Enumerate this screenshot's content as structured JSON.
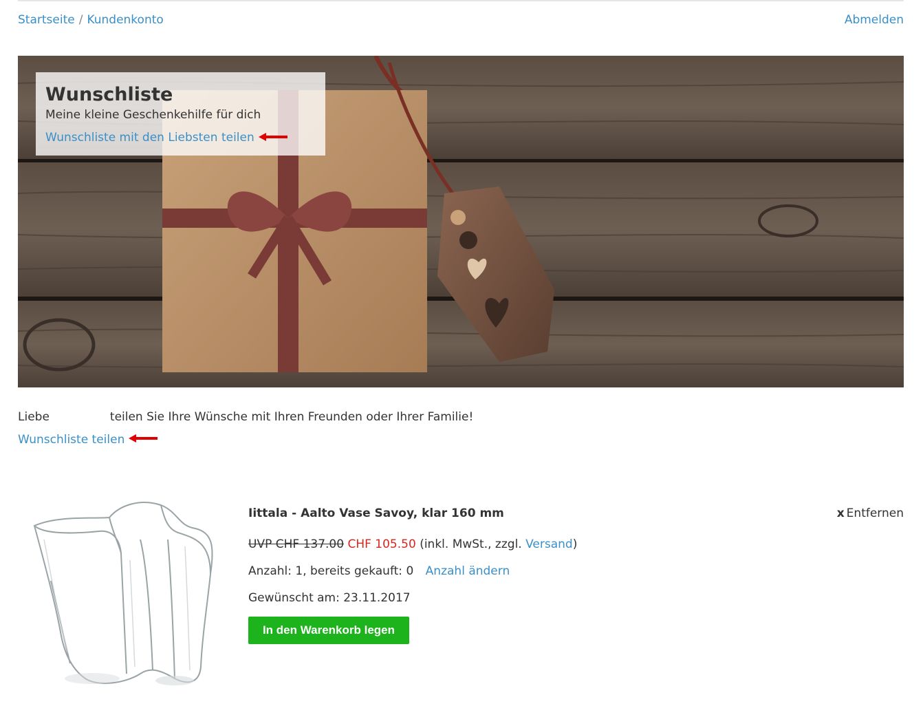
{
  "breadcrumb": {
    "home": "Startseite",
    "separator": "/",
    "current": "Kundenkonto"
  },
  "header": {
    "logout": "Abmelden"
  },
  "hero": {
    "title": "Wunschliste",
    "subtitle": "Meine kleine Geschenkehilfe für dich",
    "share_link": "Wunschliste mit den Liebsten teilen"
  },
  "intro": {
    "greeting": "Liebe",
    "text": "teilen Sie Ihre Wünsche mit Ihren Freunden oder Ihrer Familie!",
    "share_link": "Wunschliste teilen"
  },
  "product": {
    "name": "Iittala - Aalto Vase Savoy, klar 160 mm",
    "remove_icon": "x",
    "remove_label": "Entfernen",
    "price_old": "UVP CHF 137.00",
    "price_new": "CHF 105.50",
    "tax_prefix": "(inkl. MwSt., zzgl.",
    "shipping_link": "Versand",
    "tax_suffix": ")",
    "quantity_text": "Anzahl: 1, bereits gekauft: 0",
    "change_quantity": "Anzahl ändern",
    "wished_on": "Gewünscht am: 23.11.2017",
    "add_to_cart": "In den Warenkorb legen"
  },
  "colors": {
    "link": "#3a8fc7",
    "price_new": "#d9261c",
    "cart_button": "#1db31d",
    "arrow": "#e00000"
  },
  "icons": {
    "annotation_arrow": "left-arrow-icon",
    "remove": "close-icon"
  }
}
